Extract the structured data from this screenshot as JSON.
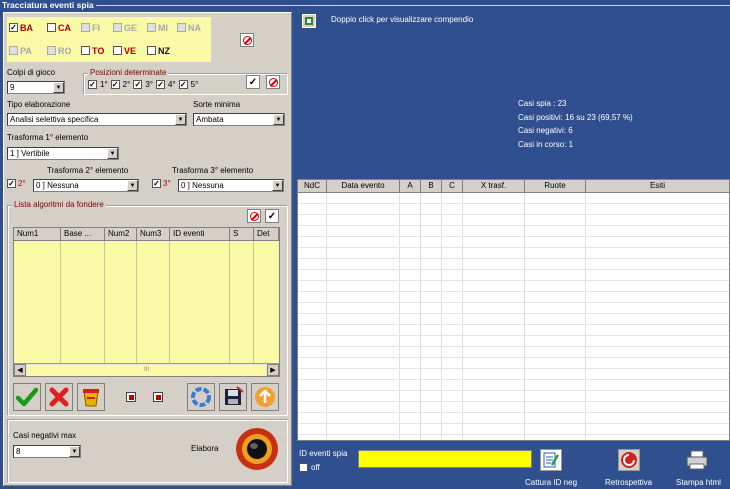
{
  "window": {
    "title": "Tracciatura eventi spia"
  },
  "wheels": [
    {
      "label": "BA",
      "checked": true,
      "style": "red"
    },
    {
      "label": "CA",
      "checked": false,
      "style": "red"
    },
    {
      "label": "FI",
      "checked": false,
      "style": "gray"
    },
    {
      "label": "GE",
      "checked": false,
      "style": "gray"
    },
    {
      "label": "MI",
      "checked": false,
      "style": "gray"
    },
    {
      "label": "NA",
      "checked": false,
      "style": "gray"
    },
    {
      "label": "PA",
      "checked": false,
      "style": "gray"
    },
    {
      "label": "RO",
      "checked": false,
      "style": "gray"
    },
    {
      "label": "TO",
      "checked": false,
      "style": "red"
    },
    {
      "label": "VE",
      "checked": false,
      "style": "red"
    },
    {
      "label": "NZ",
      "checked": false,
      "style": "blk"
    }
  ],
  "colpi": {
    "label": "Colpi di gioco",
    "value": "9"
  },
  "posizioni": {
    "label": "Posizioni determinate",
    "items": [
      "1°",
      "2°",
      "3°",
      "4°",
      "5°"
    ],
    "check_glyph": "✓"
  },
  "tipo": {
    "label": "Tipo elaborazione",
    "value": "Analisi selettiva specifica"
  },
  "sorte": {
    "label": "Sorte minima",
    "value": "Ambata"
  },
  "trasf1": {
    "label": "Trasforma 1° elemento",
    "value": "1 ] Vertibile"
  },
  "trasf2": {
    "label": "Trasforma 2° elemento",
    "check_label": "2°",
    "value": "0 ] Nessuna"
  },
  "trasf3": {
    "label": "Trasforma 3° elemento",
    "check_label": "3°",
    "value": "0 ] Nessuna"
  },
  "algoritmi": {
    "label": "Lista algoritmi da fondere",
    "check_glyph": "✓",
    "columns": [
      "Num1",
      "Base ...",
      "Num2",
      "Num3",
      "ID eventi",
      "S",
      "Det"
    ],
    "scroll_glyph": "III"
  },
  "casi_neg_max": {
    "label": "Casi negativi max",
    "value": "8"
  },
  "elabora": {
    "label": "Elabora"
  },
  "compendio": {
    "text": "Doppio click per visualizzare compendio"
  },
  "stats": [
    "Casi spia : 23",
    "Casi positivi: 16 su 23 (69,57 %)",
    "Casi negativi: 6",
    "Casi in corso: 1"
  ],
  "results": {
    "columns": [
      "NdC",
      "Data evento",
      "A",
      "B",
      "C",
      "X trasf.",
      "Ruote",
      "Esiti"
    ]
  },
  "id_eventi": {
    "label": "ID eventi spia",
    "off_label": "off",
    "value": ""
  },
  "buttons": {
    "cattura": "Cattura ID neg",
    "retro": "Retrospettiva",
    "stampa": "Stampa html"
  },
  "colors": {
    "background": "#2f4f8f",
    "panel": "#d4d0c8",
    "highlight": "#fafaa6",
    "input_yellow": "#ffff00",
    "accent_red": "#b00000"
  }
}
